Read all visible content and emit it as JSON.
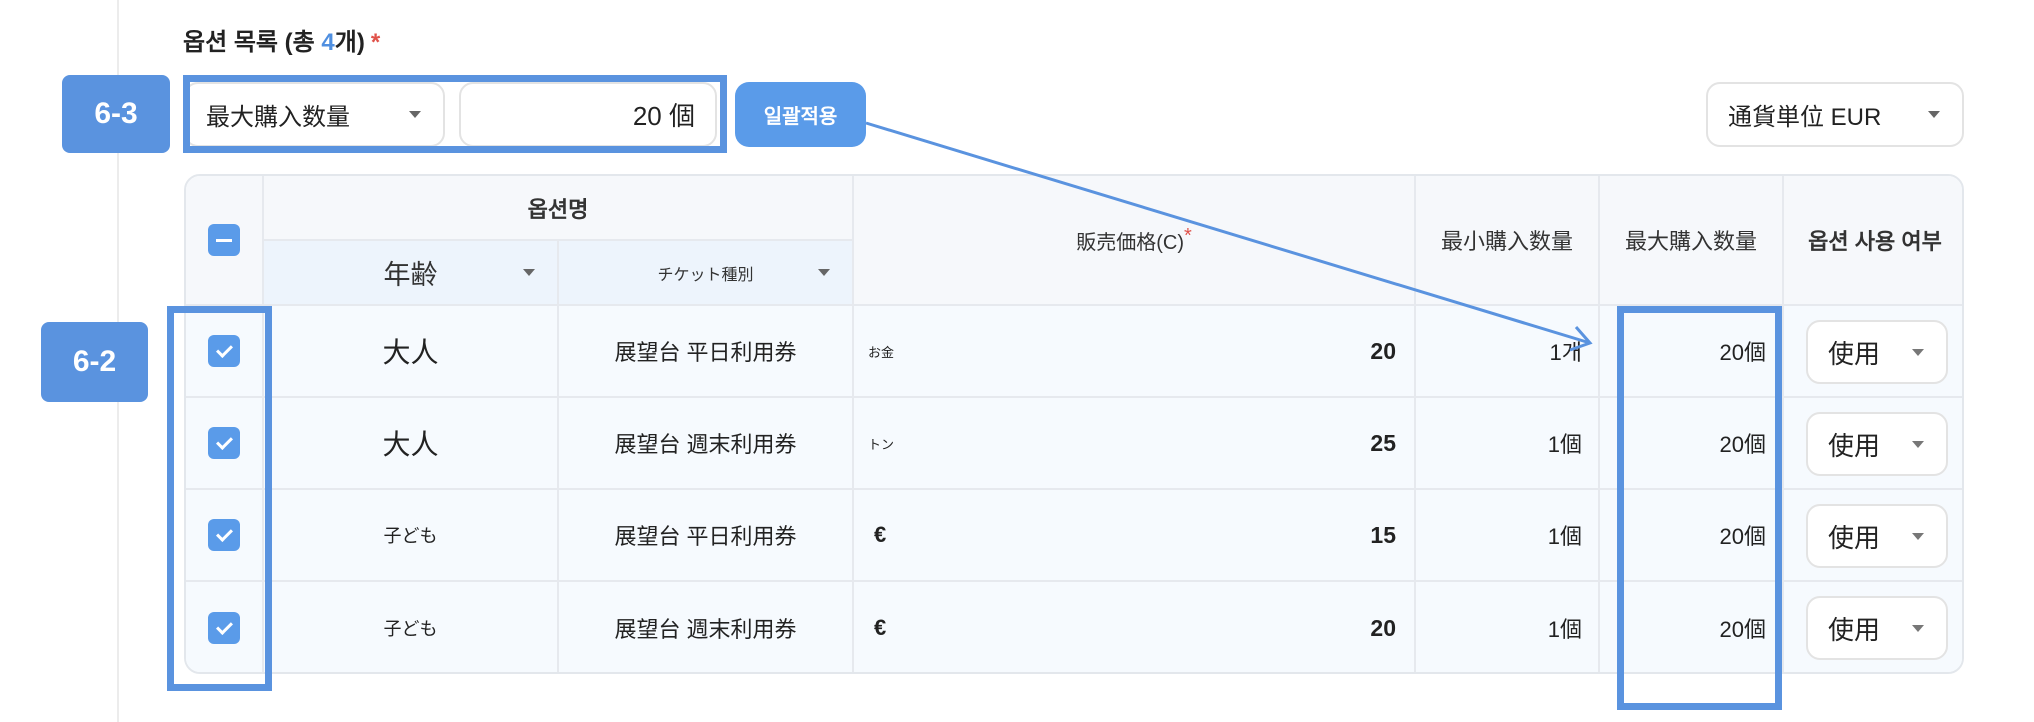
{
  "section": {
    "title": "옵션 목록 (총 ",
    "count": "4",
    "suffix": "개)",
    "required_mark": "*"
  },
  "badges": {
    "bulk": "6-3",
    "rows": "6-2"
  },
  "bulk_bar": {
    "field_select": "最大購入数量",
    "value_input": "20 個",
    "apply_label": "일괄적용",
    "currency_select": "通貨単位 EUR"
  },
  "table": {
    "header": {
      "option_name": "옵션명",
      "sub_age": "年齢",
      "sub_ticket": "チケット種別",
      "price": "販売価格(C)",
      "price_required": "*",
      "min_qty": "最小購入数量",
      "max_qty": "最大購入数量",
      "use": "옵션 사용 여부"
    },
    "rows": [
      {
        "age": "大人",
        "ticket": "展望台 平日利用券",
        "currency": "お金",
        "price": "20",
        "min": "1개",
        "max": "20個",
        "use": "使用"
      },
      {
        "age": "大人",
        "ticket": "展望台 週末利用券",
        "currency": "トン",
        "price": "25",
        "min": "1個",
        "max": "20個",
        "use": "使用"
      },
      {
        "age": "子ども",
        "ticket": "展望台 平日利用券",
        "currency": "€",
        "price": "15",
        "min": "1個",
        "max": "20個",
        "use": "使用"
      },
      {
        "age": "子ども",
        "ticket": "展望台 週末利用券",
        "currency": "€",
        "price": "20",
        "min": "1個",
        "max": "20個",
        "use": "使用"
      }
    ]
  },
  "colors": {
    "accent": "#5a93df",
    "button": "#5a9be9",
    "required": "#e0524a"
  }
}
